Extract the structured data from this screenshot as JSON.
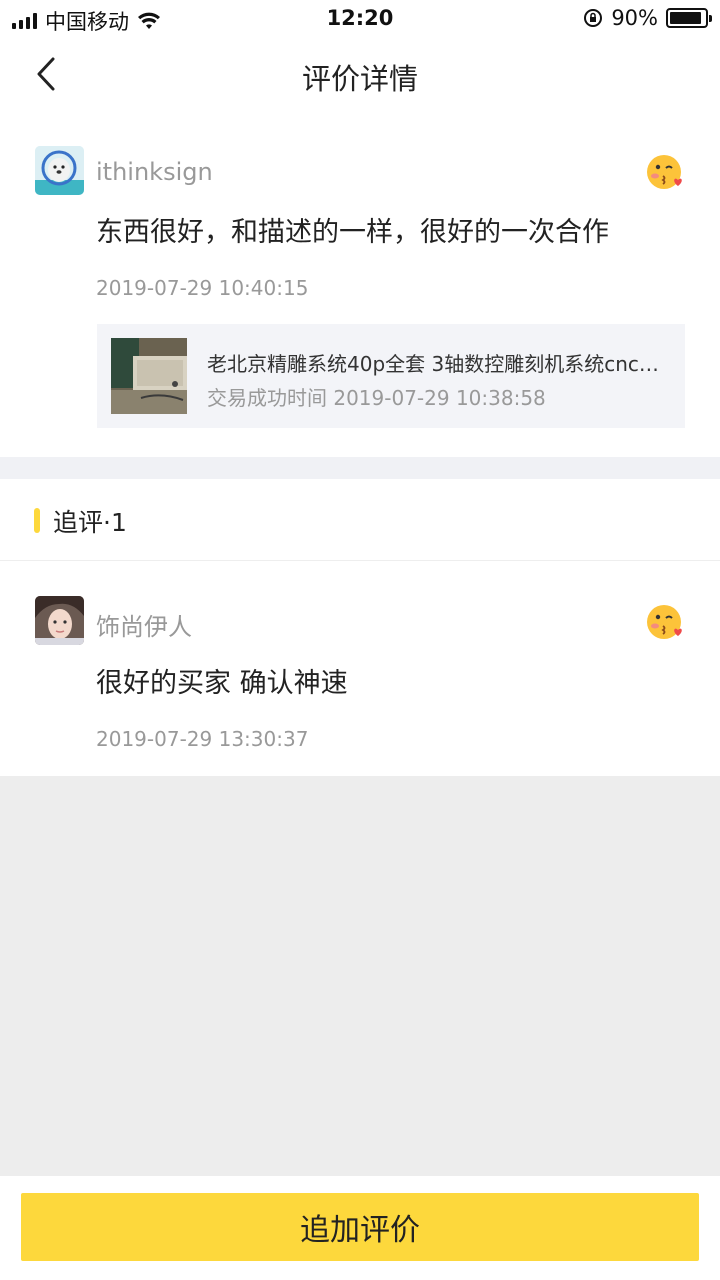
{
  "status_bar": {
    "carrier": "中国移动",
    "time": "12:20",
    "battery": "90%",
    "battery_level": 0.9
  },
  "nav": {
    "title": "评价详情"
  },
  "review": {
    "username": "ithinksign",
    "comment": "东西很好，和描述的一样，很好的一次合作",
    "timestamp": "2019-07-29 10:40:15",
    "product": {
      "title": "老北京精雕系统40p全套 3轴数控雕刻机系统cnc…",
      "trade_time": "交易成功时间 2019-07-29 10:38:58"
    }
  },
  "follow_up": {
    "section_title": "追评·1",
    "username": "饰尚伊人",
    "comment": "很好的买家 确认神速",
    "timestamp": "2019-07-29 13:30:37"
  },
  "bottom": {
    "button_label": "追加评价"
  },
  "colors": {
    "accent": "#fdd83c"
  }
}
